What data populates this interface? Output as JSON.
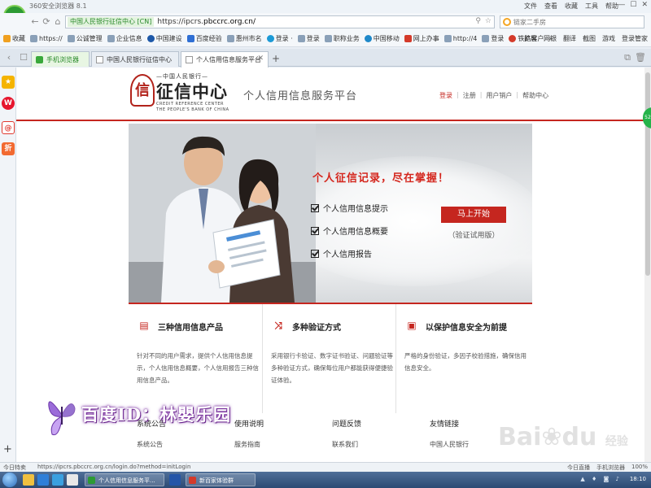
{
  "browser": {
    "app_title": "360安全浏览器 8.1",
    "menus": [
      "文件",
      "查看",
      "收藏",
      "工具",
      "帮助"
    ],
    "address": {
      "secure_label": "中国人民银行征信中心 [CN]",
      "url_prefix": "https://ipcrs.",
      "url_domain": "pbccrc.org.cn/"
    },
    "search_placeholder": "链家二手房",
    "bookmarks": [
      {
        "label": "收藏",
        "color": "#f0a020"
      },
      {
        "label": "https://",
        "color": "#8aa0b8"
      },
      {
        "label": "公诚管理",
        "color": "#8aa0b8"
      },
      {
        "label": "企业信息",
        "color": "#8aa0b8"
      },
      {
        "label": "中国建设",
        "color": "#1d58a8"
      },
      {
        "label": "百度经验",
        "color": "#2f6fd4"
      },
      {
        "label": "惠州市名",
        "color": "#8aa0b8"
      },
      {
        "label": "登录 ·",
        "color": "#1c9ad6"
      },
      {
        "label": "登录",
        "color": "#8aa0b8"
      },
      {
        "label": "职称业务",
        "color": "#8aa0b8"
      },
      {
        "label": "中国移动",
        "color": "#1e88c9"
      },
      {
        "label": "网上办事",
        "color": "#d43a2a"
      },
      {
        "label": "http://4",
        "color": "#8aa0b8"
      },
      {
        "label": "登录",
        "color": "#8aa0b8"
      },
      {
        "label": "铁路客户",
        "color": "#d43a2a"
      }
    ],
    "bookmark_more": "»",
    "right_tools": [
      "扩展",
      "网银",
      "翻译",
      "截图",
      "游戏",
      "登录管家"
    ],
    "tabs": [
      {
        "label": "手机浏览器"
      },
      {
        "label": "中国人民银行征信中心"
      },
      {
        "label": "个人信用信息服务平台"
      }
    ],
    "new_tab": "+"
  },
  "site": {
    "org_top": "—中国人民银行—",
    "org_name": "征信中心",
    "org_en1": "CREDIT REFERENCE CENTER",
    "org_en2": "THE PEOPLE'S BANK OF CHINA",
    "platform_name": "个人信用信息服务平台",
    "top_links": {
      "login": "登录",
      "register": "注册",
      "user_account": "用户销户",
      "help": "帮助中心"
    }
  },
  "hero": {
    "title": "个人征信记录，尽在掌握！",
    "items": [
      "个人信用信息提示",
      "个人信用信息概要",
      "个人信用报告"
    ],
    "start_button": "马上开始",
    "start_sub": "（验证试用版）"
  },
  "features": [
    {
      "icon": "report-icon",
      "title": "三种信用信息产品",
      "desc": [
        "针对不同的用户需求，提供个人信用信息提",
        "示，个人信用信息概要，个人信用报告三种信",
        "用信息产品。"
      ]
    },
    {
      "icon": "shuffle-icon",
      "title": "多种验证方式",
      "desc": [
        "采用银行卡验证、数字证书验证、问题验证等",
        "多种验证方式，确保每位用户都能获得便捷验",
        "证体验。"
      ]
    },
    {
      "icon": "id-card-icon",
      "title": "以保护信息安全为前提",
      "desc": [
        "严格的身份验证，多因子校验措施，确保信用",
        "信息安全。"
      ]
    }
  ],
  "footer": [
    {
      "heading": "系统公告",
      "link": "系统公告"
    },
    {
      "heading": "使用说明",
      "link": "服务指南"
    },
    {
      "heading": "问题反馈",
      "link": "联系我们"
    },
    {
      "heading": "友情链接",
      "link": "中国人民银行"
    }
  ],
  "watermark": {
    "text": "百度ID：林嬰乐园",
    "baidu_logo": "Bai",
    "baidu_logo_2": "du",
    "baidu_sub": "经验"
  },
  "statusbar": {
    "left": "今日特卖",
    "url": "https://ipcrs.pbccrc.org.cn/login.do?method=initLogin",
    "right": [
      "今日直播",
      "手机浏览器",
      "100%"
    ]
  },
  "taskbar": {
    "tasks": [
      {
        "label": "个人信用信息服务平...",
        "color": "#2c9a33"
      },
      {
        "label": "新百家体验群",
        "color": "#d43a2a"
      }
    ],
    "clock": "18:10",
    "tray": "▲ ♦ ◙ ♪"
  }
}
